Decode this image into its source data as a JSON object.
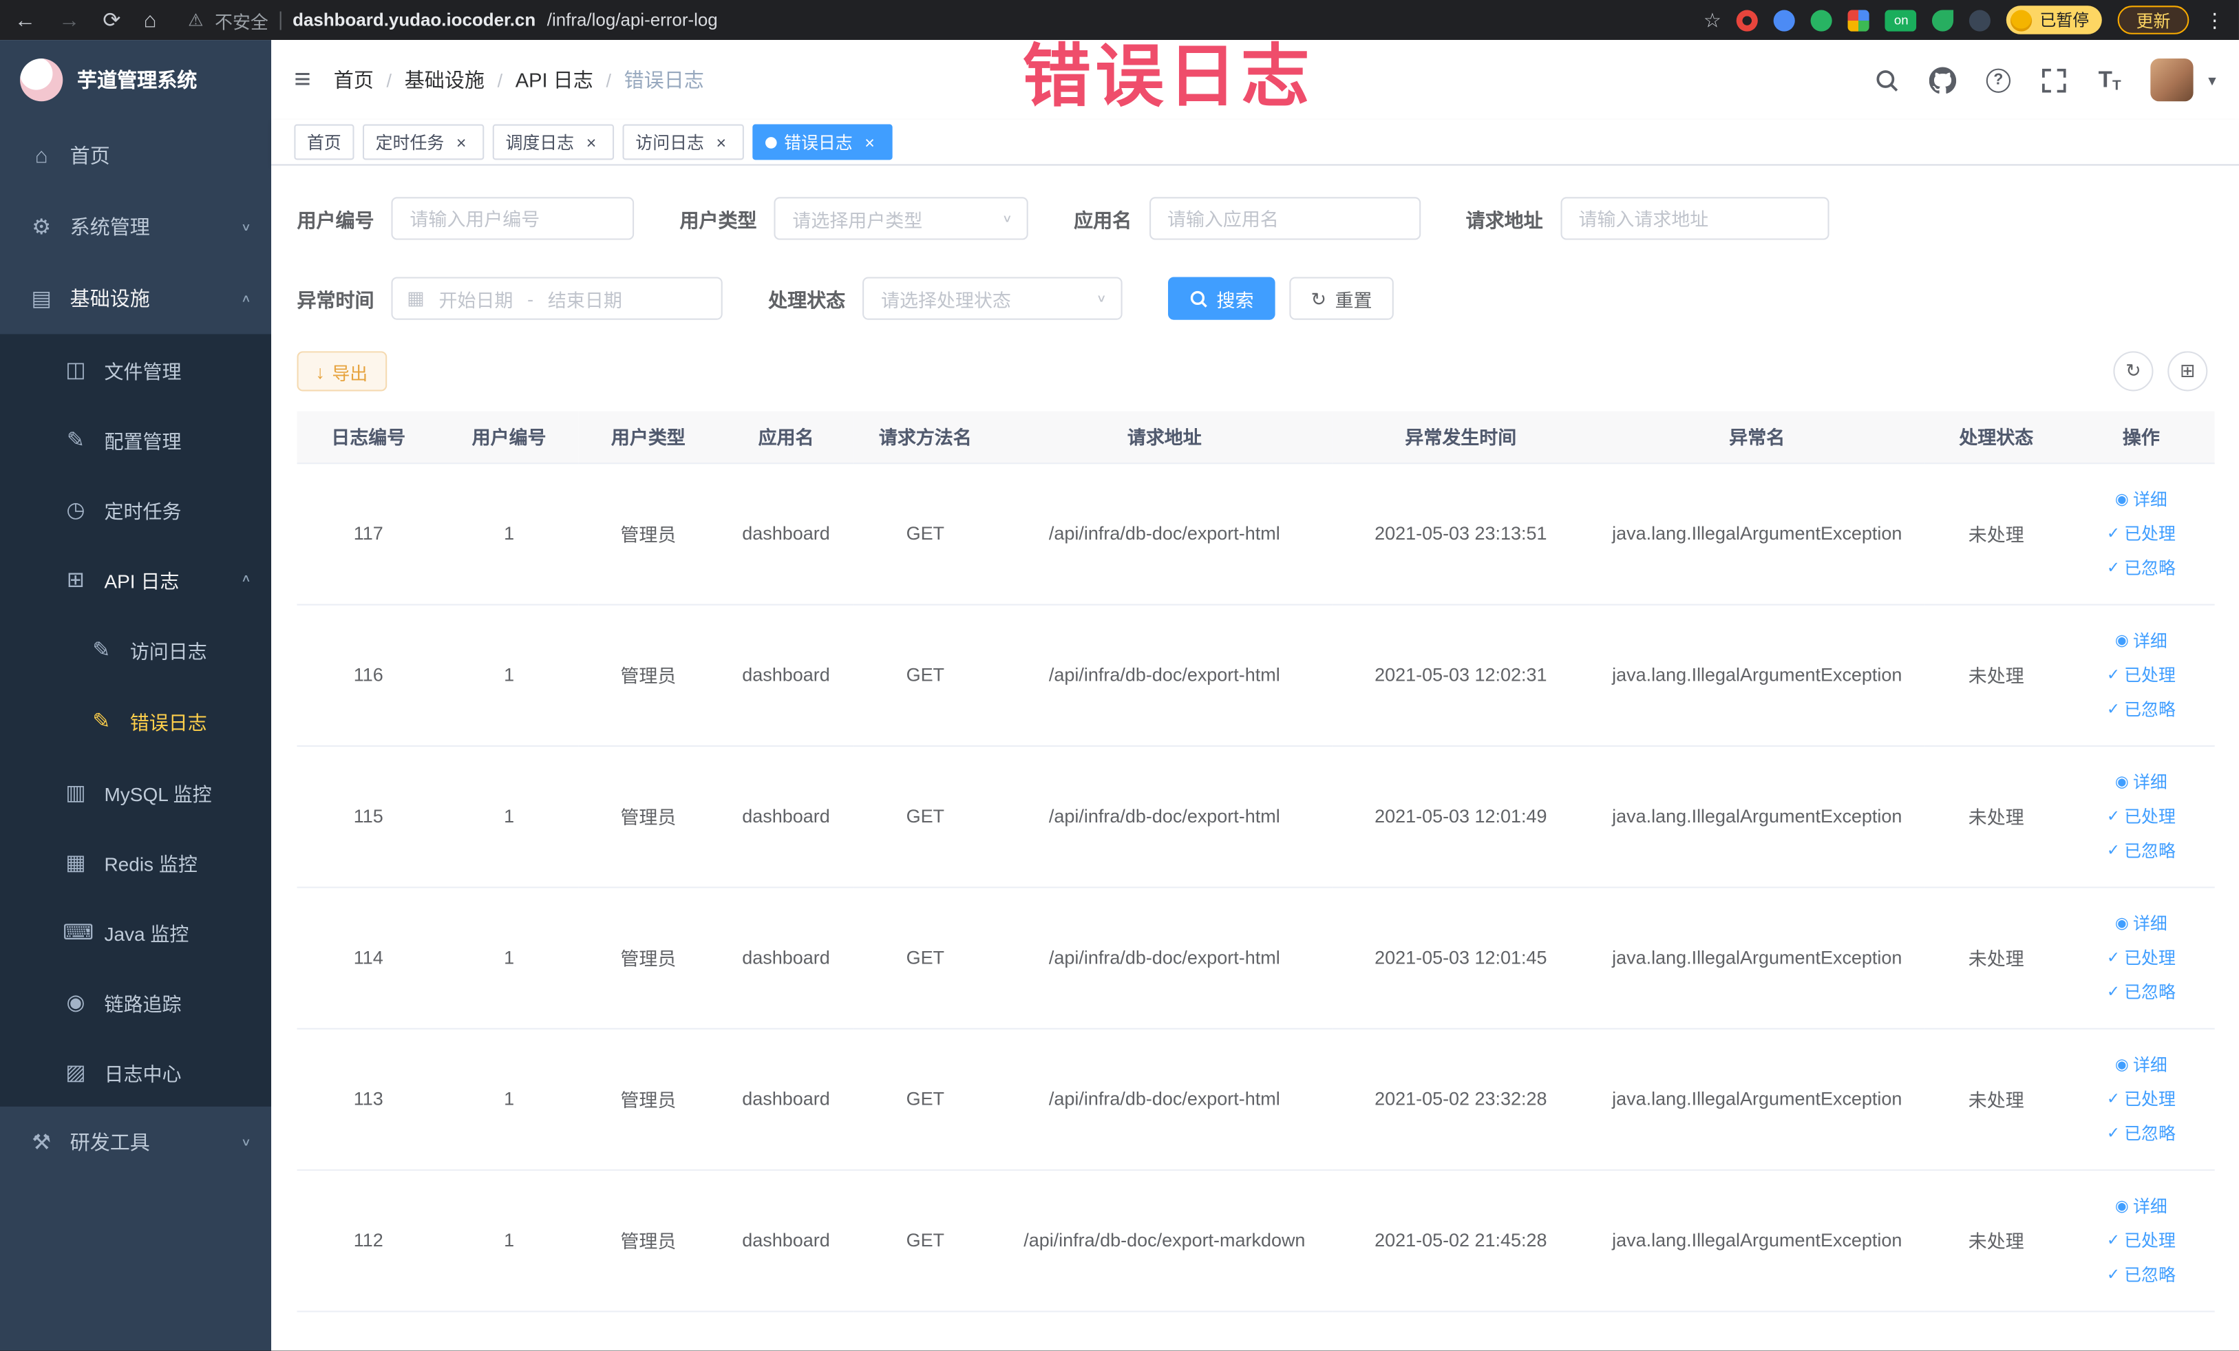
{
  "browser": {
    "security_label": "不安全",
    "url_domain": "dashboard.yudao.iocoder.cn",
    "url_path": "/infra/log/api-error-log",
    "extension_on_label": "on",
    "profile_badge": "已暂停",
    "update_button": "更新"
  },
  "icons": {
    "back": "←",
    "forward": "→",
    "reload": "⟳",
    "home": "⌂",
    "warning": "⚠",
    "star": "☆",
    "kebab": "⋮",
    "hamburger": "≡",
    "caret_down": "▾",
    "help": "?",
    "font_size_big": "T",
    "font_size_small": "T",
    "chev_down": "∨",
    "chev_up": "∧",
    "menu_home": "⌂",
    "menu_system": "⚙",
    "menu_infra": "▤",
    "menu_file": "◫",
    "menu_config": "✎",
    "menu_job": "◷",
    "menu_apilog": "⊞",
    "menu_accesslog": "✎",
    "menu_errorlog": "✎",
    "menu_mysql": "▥",
    "menu_redis": "▦",
    "menu_java": "⌨",
    "menu_trace": "◉",
    "menu_logcenter": "▨",
    "menu_devtools": "⚒",
    "calendar": "▦",
    "refresh": "↻",
    "columns": "⊞",
    "download": "↓",
    "close": "×",
    "eye": "◉",
    "check": "✓"
  },
  "sidebar": {
    "logo_title": "芋道管理系统",
    "menu": [
      {
        "label": "首页"
      },
      {
        "label": "系统管理"
      },
      {
        "label": "基础设施",
        "children": [
          {
            "label": "文件管理"
          },
          {
            "label": "配置管理"
          },
          {
            "label": "定时任务"
          },
          {
            "label": "API 日志",
            "children": [
              {
                "label": "访问日志"
              },
              {
                "label": "错误日志",
                "active": true
              }
            ]
          },
          {
            "label": "MySQL 监控"
          },
          {
            "label": "Redis 监控"
          },
          {
            "label": "Java 监控"
          },
          {
            "label": "链路追踪"
          },
          {
            "label": "日志中心"
          }
        ]
      },
      {
        "label": "研发工具"
      }
    ]
  },
  "header": {
    "breadcrumb": [
      "首页",
      "基础设施",
      "API 日志",
      "错误日志"
    ],
    "breadcrumb_separator": "/",
    "watermark": "错误日志"
  },
  "tabs": [
    {
      "label": "首页"
    },
    {
      "label": "定时任务"
    },
    {
      "label": "调度日志"
    },
    {
      "label": "访问日志"
    },
    {
      "label": "错误日志"
    }
  ],
  "filters": {
    "user_id": {
      "label": "用户编号",
      "placeholder": "请输入用户编号"
    },
    "user_type": {
      "label": "用户类型",
      "placeholder": "请选择用户类型"
    },
    "app_name": {
      "label": "应用名",
      "placeholder": "请输入应用名"
    },
    "request_url": {
      "label": "请求地址",
      "placeholder": "请输入请求地址"
    },
    "exception_time": {
      "label": "异常时间",
      "start_placeholder": "开始日期",
      "separator": "-",
      "end_placeholder": "结束日期"
    },
    "process_status": {
      "label": "处理状态",
      "placeholder": "请选择处理状态"
    },
    "search_button": "搜索",
    "reset_button": "重置"
  },
  "toolbar": {
    "export_button": "导出"
  },
  "table": {
    "columns": [
      "日志编号",
      "用户编号",
      "用户类型",
      "应用名",
      "请求方法名",
      "请求地址",
      "异常发生时间",
      "异常名",
      "处理状态",
      "操作"
    ],
    "column_keys": [
      "id",
      "user_id",
      "user_type",
      "app",
      "method",
      "url",
      "time",
      "exception",
      "status"
    ],
    "actions": [
      "详细",
      "已处理",
      "已忽略"
    ],
    "rows": [
      {
        "id": "117",
        "user_id": "1",
        "user_type": "管理员",
        "app": "dashboard",
        "method": "GET",
        "url": "/api/infra/db-doc/export-html",
        "time": "2021-05-03 23:13:51",
        "exception": "java.lang.IllegalArgumentException",
        "status": "未处理"
      },
      {
        "id": "116",
        "user_id": "1",
        "user_type": "管理员",
        "app": "dashboard",
        "method": "GET",
        "url": "/api/infra/db-doc/export-html",
        "time": "2021-05-03 12:02:31",
        "exception": "java.lang.IllegalArgumentException",
        "status": "未处理"
      },
      {
        "id": "115",
        "user_id": "1",
        "user_type": "管理员",
        "app": "dashboard",
        "method": "GET",
        "url": "/api/infra/db-doc/export-html",
        "time": "2021-05-03 12:01:49",
        "exception": "java.lang.IllegalArgumentException",
        "status": "未处理"
      },
      {
        "id": "114",
        "user_id": "1",
        "user_type": "管理员",
        "app": "dashboard",
        "method": "GET",
        "url": "/api/infra/db-doc/export-html",
        "time": "2021-05-03 12:01:45",
        "exception": "java.lang.IllegalArgumentException",
        "status": "未处理"
      },
      {
        "id": "113",
        "user_id": "1",
        "user_type": "管理员",
        "app": "dashboard",
        "method": "GET",
        "url": "/api/infra/db-doc/export-html",
        "time": "2021-05-02 23:32:28",
        "exception": "java.lang.IllegalArgumentException",
        "status": "未处理"
      },
      {
        "id": "112",
        "user_id": "1",
        "user_type": "管理员",
        "app": "dashboard",
        "method": "GET",
        "url": "/api/infra/db-doc/export-markdown",
        "time": "2021-05-02 21:45:28",
        "exception": "java.lang.IllegalArgumentException",
        "status": "未处理"
      }
    ]
  },
  "colors": {
    "accent": "#409eff",
    "sidebar_bg": "#304156",
    "submenu_bg": "#1f2d3d",
    "active_menu": "#ffd04b",
    "warning": "#e6a23c",
    "annotation": "#ef4d6b"
  }
}
